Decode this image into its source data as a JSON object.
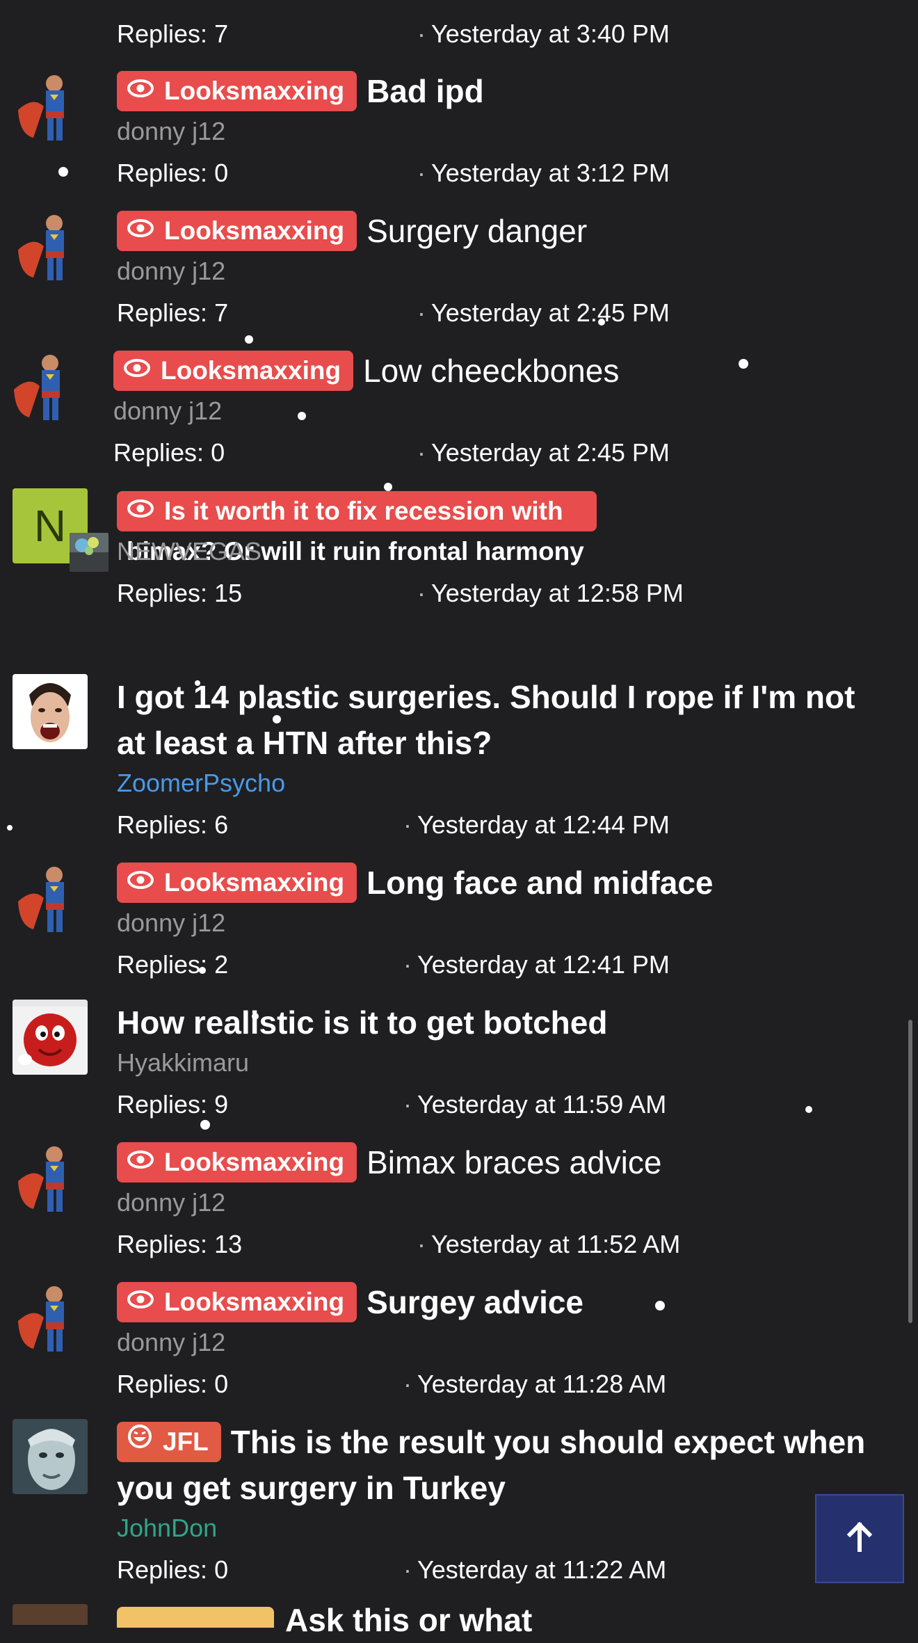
{
  "threads": [
    {
      "replies": "Replies: 7",
      "time": "Yesterday at 3:40 PM"
    },
    {
      "prefix": "Looksmaxxing",
      "title": "Bad ipd",
      "author": "donny j12",
      "replies": "Replies: 0",
      "time": "Yesterday at 3:12 PM"
    },
    {
      "prefix": "Looksmaxxing",
      "title": "Surgery danger",
      "author": "donny j12",
      "replies": "Replies: 7",
      "time": "Yesterday at 2:45 PM"
    },
    {
      "prefix": "Looksmaxxing",
      "title": "Low cheeckbones",
      "author": "donny j12",
      "replies": "Replies: 0",
      "time": "Yesterday at 2:45 PM"
    },
    {
      "avatar_letter": "N",
      "prefix": "Looksmaxxing",
      "title_line1": "Is it worth it to fix recession with",
      "title_line2": "bimax? Or will it ruin frontal harmony",
      "author": "NEWVEGAS",
      "replies": "Replies: 15",
      "time": "Yesterday at 12:58 PM"
    },
    {
      "title_line1": "I got 14 plastic surgeries. Should I rope if I'm not",
      "title_line2": "at least a HTN after this?",
      "author": "ZoomerPsycho",
      "replies": "Replies: 6",
      "time": "Yesterday at 12:44 PM"
    },
    {
      "prefix": "Looksmaxxing",
      "title": "Long face and midface",
      "author": "donny j12",
      "replies": "Replies: 2",
      "time": "Yesterday at 12:41 PM"
    },
    {
      "title": "How realistic is it to get botched",
      "author": "Hyakkimaru",
      "replies": "Replies: 9",
      "time": "Yesterday at 11:59 AM"
    },
    {
      "prefix": "Looksmaxxing",
      "title": "Bimax braces advice",
      "author": "donny j12",
      "replies": "Replies: 13",
      "time": "Yesterday at 11:52 AM"
    },
    {
      "prefix": "Looksmaxxing",
      "title": "Surgey advice",
      "author": "donny j12",
      "replies": "Replies: 0",
      "time": "Yesterday at 11:28 AM"
    },
    {
      "prefix": "JFL",
      "title_line1": "This is the result you should expect when",
      "title_line2": "you get surgery in Turkey",
      "author": "JohnDon",
      "replies": "Replies: 0",
      "time": "Yesterday at 11:22 AM"
    }
  ],
  "partial_next_title": "Ask this or what",
  "icons": {
    "prefix_looksmaxxing": "eye-icon",
    "prefix_jfl": "laughing-face-icon",
    "back_to_top": "arrow-up-icon"
  },
  "colors": {
    "background": "#1f1f21",
    "prefix_red": "#e84c4c",
    "prefix_jfl": "#e05a44",
    "author_gray": "#9a9a9a",
    "author_blue": "#4a9ae8",
    "author_teal": "#2fa58c",
    "back_to_top": "#24316e"
  }
}
